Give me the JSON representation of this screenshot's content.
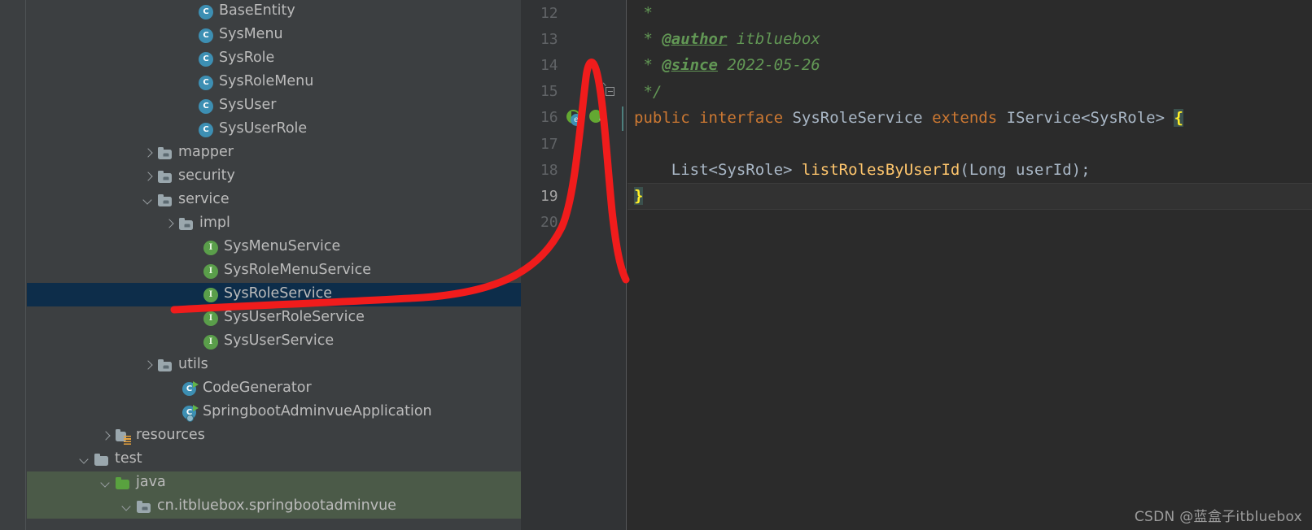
{
  "project_tree": {
    "name": "Project tool window",
    "rows": [
      {
        "label": "BaseEntity",
        "indent": 190,
        "arrow": "none",
        "icon": "class-icon",
        "state": "normal"
      },
      {
        "label": "SysMenu",
        "indent": 190,
        "arrow": "none",
        "icon": "class-icon",
        "state": "normal"
      },
      {
        "label": "SysRole",
        "indent": 190,
        "arrow": "none",
        "icon": "class-icon",
        "state": "normal"
      },
      {
        "label": "SysRoleMenu",
        "indent": 190,
        "arrow": "none",
        "icon": "class-icon",
        "state": "normal"
      },
      {
        "label": "SysUser",
        "indent": 190,
        "arrow": "none",
        "icon": "class-icon",
        "state": "normal"
      },
      {
        "label": "SysUserRole",
        "indent": 190,
        "arrow": "none",
        "icon": "class-icon",
        "state": "normal"
      },
      {
        "label": "mapper",
        "indent": 140,
        "arrow": "collapsed",
        "icon": "package-folder-icon",
        "state": "normal"
      },
      {
        "label": "security",
        "indent": 140,
        "arrow": "collapsed",
        "icon": "package-folder-icon",
        "state": "normal"
      },
      {
        "label": "service",
        "indent": 140,
        "arrow": "expanded",
        "icon": "package-folder-icon",
        "state": "normal"
      },
      {
        "label": "impl",
        "indent": 166,
        "arrow": "collapsed",
        "icon": "package-folder-icon",
        "state": "normal"
      },
      {
        "label": "SysMenuService",
        "indent": 196,
        "arrow": "none",
        "icon": "interface-icon",
        "state": "normal"
      },
      {
        "label": "SysRoleMenuService",
        "indent": 196,
        "arrow": "none",
        "icon": "interface-icon",
        "state": "normal"
      },
      {
        "label": "SysRoleService",
        "indent": 196,
        "arrow": "none",
        "icon": "interface-icon",
        "state": "selected"
      },
      {
        "label": "SysUserRoleService",
        "indent": 196,
        "arrow": "none",
        "icon": "interface-icon",
        "state": "normal"
      },
      {
        "label": "SysUserService",
        "indent": 196,
        "arrow": "none",
        "icon": "interface-icon",
        "state": "normal"
      },
      {
        "label": "utils",
        "indent": 140,
        "arrow": "collapsed",
        "icon": "package-folder-icon",
        "state": "normal"
      },
      {
        "label": "CodeGenerator",
        "indent": 170,
        "arrow": "none",
        "icon": "runnable-class-icon",
        "state": "normal"
      },
      {
        "label": "SpringbootAdminvueApplication",
        "indent": 170,
        "arrow": "none",
        "icon": "spring-boot-app-icon",
        "state": "normal"
      },
      {
        "label": "resources",
        "indent": 88,
        "arrow": "collapsed",
        "icon": "resources-folder-icon",
        "state": "normal"
      },
      {
        "label": "test",
        "indent": 62,
        "arrow": "expanded",
        "icon": "folder-icon",
        "state": "normal"
      },
      {
        "label": "java",
        "indent": 88,
        "arrow": "expanded",
        "icon": "test-source-folder-icon",
        "state": "test-source"
      },
      {
        "label": "cn.itbluebox.springbootadminvue",
        "indent": 114,
        "arrow": "expanded",
        "icon": "package-folder-icon",
        "state": "test-source"
      }
    ]
  },
  "editor": {
    "name": "Code editor",
    "file_interface": "SysRoleService",
    "gutter": {
      "line_numbers": [
        "12",
        "13",
        "14",
        "15",
        "16",
        "17",
        "18",
        "19",
        "20"
      ],
      "current_line": "19",
      "fold_marker_line": "15",
      "implemented_by_icon_line": "16"
    },
    "lines": [
      {
        "number": "12",
        "tokens": [
          {
            "text": " *",
            "style": "comment"
          }
        ]
      },
      {
        "number": "13",
        "tokens": [
          {
            "text": " * ",
            "style": "comment"
          },
          {
            "text": "@author",
            "style": "javadoc-tag"
          },
          {
            "text": " itbluebox",
            "style": "comment"
          }
        ]
      },
      {
        "number": "14",
        "tokens": [
          {
            "text": " * ",
            "style": "comment"
          },
          {
            "text": "@since",
            "style": "javadoc-tag"
          },
          {
            "text": " 2022-05-26",
            "style": "comment"
          }
        ]
      },
      {
        "number": "15",
        "tokens": [
          {
            "text": " */",
            "style": "comment"
          }
        ]
      },
      {
        "number": "16",
        "tokens": [
          {
            "text": "public interface",
            "style": "keyword"
          },
          {
            "text": " SysRoleService ",
            "style": "type"
          },
          {
            "text": "extends",
            "style": "keyword"
          },
          {
            "text": " IService<SysRole> ",
            "style": "type"
          },
          {
            "text": "{",
            "style": "brace-highlight"
          }
        ]
      },
      {
        "number": "17",
        "tokens": [
          {
            "text": "",
            "style": "plain"
          }
        ]
      },
      {
        "number": "18",
        "tokens": [
          {
            "text": "    List<SysRole> ",
            "style": "type"
          },
          {
            "text": "listRolesByUserId",
            "style": "method"
          },
          {
            "text": "(Long userId);",
            "style": "type"
          }
        ]
      },
      {
        "number": "19",
        "tokens": [
          {
            "text": "}",
            "style": "brace-highlight"
          }
        ]
      },
      {
        "number": "20",
        "tokens": [
          {
            "text": "",
            "style": "plain"
          }
        ]
      }
    ]
  },
  "annotation": {
    "name": "hand-drawn red highlight",
    "color": "#f01c1c",
    "description": "red marker stroke underlining SysRoleService in tree and pointing up to line 16 in the editor"
  },
  "watermark": {
    "text": "CSDN @蓝盒子itbluebox"
  },
  "colors": {
    "sidebar_bg": "#3c3f41",
    "editor_bg": "#2b2b2b",
    "gutter_bg": "#313335",
    "selection_bg": "#0d2d4a",
    "test_source_bg": "#4b5a48",
    "text_fg": "#bbbbbb",
    "line_number_fg": "#606366",
    "comment_green": "#629755",
    "keyword_orange": "#cc7832",
    "method_yellow": "#ffc66d",
    "type_blue_gray": "#a9b7c6",
    "brace_yellow": "#ffef28",
    "annotation_red": "#f01c1c"
  }
}
